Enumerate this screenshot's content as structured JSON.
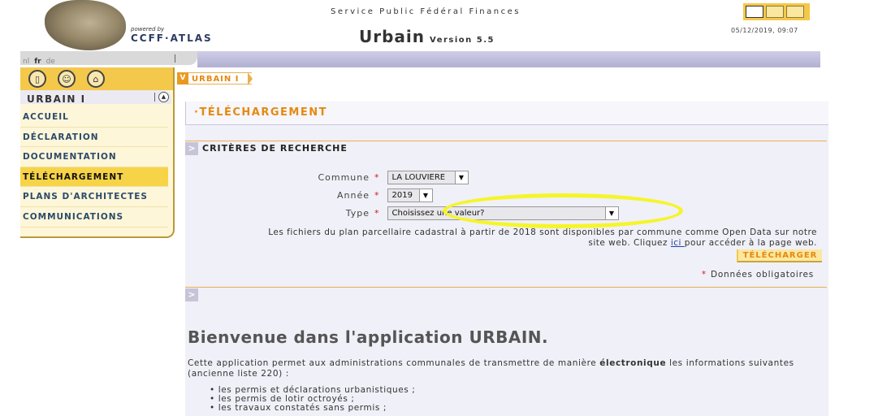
{
  "header": {
    "powered_by": "powered by",
    "brand": "CCFF·ATLAS",
    "org": "Service Public Fédéral Finances",
    "app_name": "Urbain",
    "app_version": "Version 5.5",
    "datetime": "05/12/2019, 09:07"
  },
  "languages": [
    {
      "code": "nl"
    },
    {
      "code": "fr"
    },
    {
      "code": "de"
    }
  ],
  "sidebar": {
    "icons": [
      "door-icon",
      "user-icon",
      "home-icon"
    ],
    "section": "URBAIN I",
    "items": [
      {
        "label": "ACCUEIL"
      },
      {
        "label": "DÉCLARATION"
      },
      {
        "label": "DOCUMENTATION"
      },
      {
        "label": "TÉLÉCHARGEMENT"
      },
      {
        "label": "PLANS D'ARCHITECTES"
      },
      {
        "label": "COMMUNICATIONS"
      }
    ]
  },
  "breadcrumb": {
    "label": "URBAIN I"
  },
  "main": {
    "title": "·TÉLÉCHARGEMENT",
    "criteria_heading": "CRITÈRES DE RECHERCHE",
    "form": {
      "commune_label": "Commune",
      "commune_value": "LA LOUVIERE",
      "annee_label": "Année",
      "annee_value": "2019",
      "type_label": "Type",
      "type_value": "Choisissez une valeur?",
      "required_mark": "*"
    },
    "info_line1": "Les fichiers du plan parcellaire cadastral à partir de 2018 sont disponibles par commune comme Open Data sur notre",
    "info_line2_pre": "site web. Cliquez ",
    "info_link": "ici ",
    "info_line2_post": "pour accéder à la page web.",
    "download_button": "TÉLÉCHARGER",
    "required_note": "Données obligatoires",
    "welcome_title": "Bienvenue dans l'application URBAIN.",
    "welcome_text_pre": "Cette application permet aux administrations communales de transmettre de manière ",
    "welcome_text_bold": "électronique",
    "welcome_text_post": " les informations suivantes (ancienne liste 220) :",
    "welcome_list": [
      "les permis et déclarations urbanistiques ;",
      "les permis de lotir octroyés ;",
      "les travaux constatés sans permis ;"
    ]
  },
  "colors": {
    "accent": "#f4c84a",
    "orange": "#e48a10",
    "highlight": "#f5f52a",
    "stripe": "#b2b0d2"
  }
}
